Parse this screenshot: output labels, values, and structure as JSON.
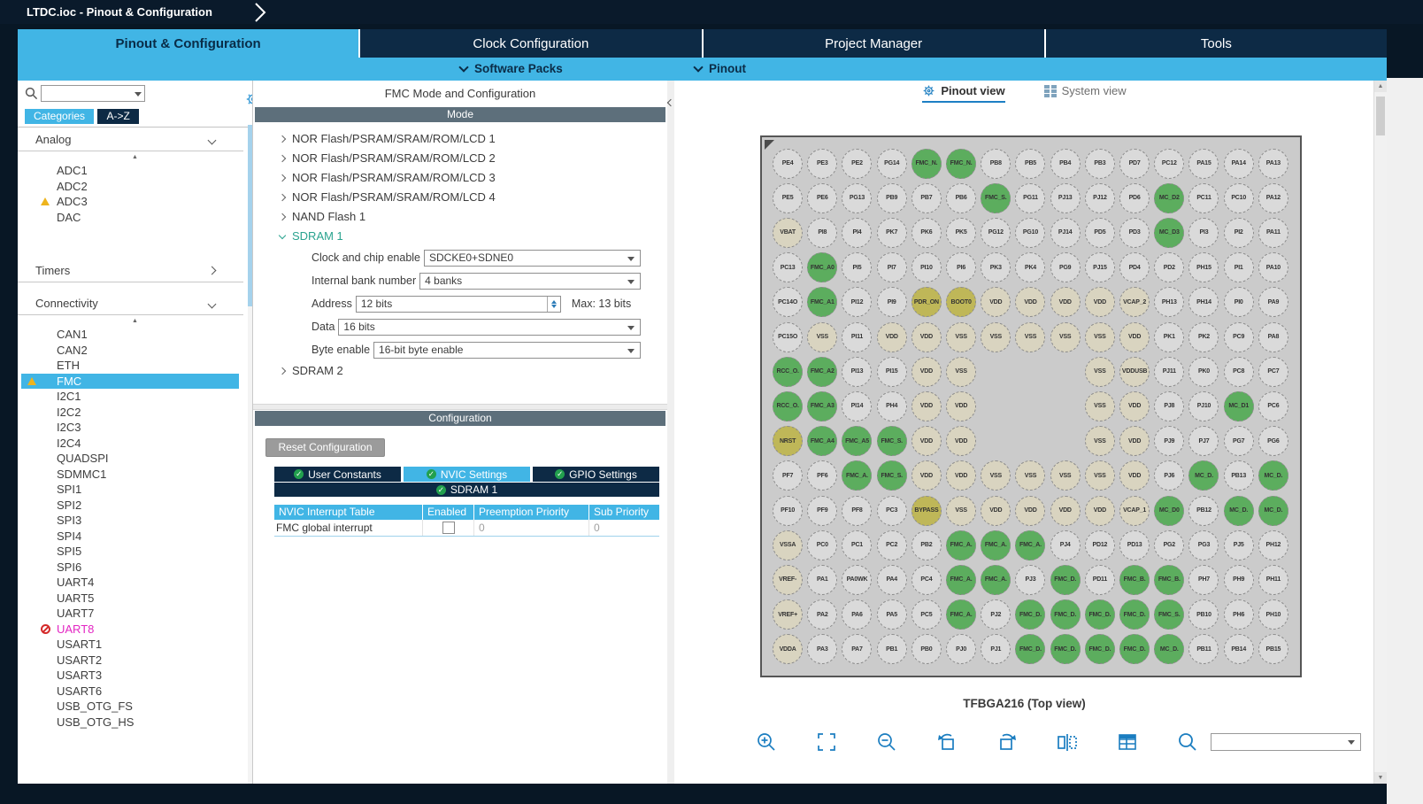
{
  "window": {
    "title": "LTDC.ioc - Pinout & Configuration"
  },
  "nav": {
    "tabs": [
      {
        "label": "Pinout & Configuration",
        "active": true
      },
      {
        "label": "Clock Configuration",
        "active": false
      },
      {
        "label": "Project Manager",
        "active": false
      },
      {
        "label": "Tools",
        "active": false
      }
    ],
    "subnav": [
      {
        "label": "Software Packs"
      },
      {
        "label": "Pinout"
      }
    ]
  },
  "sidebar": {
    "search_value": "",
    "tabs": [
      {
        "label": "Categories",
        "active": true
      },
      {
        "label": "A->Z",
        "active": false
      }
    ],
    "groups": [
      {
        "label": "Analog",
        "expanded": true,
        "items": [
          {
            "label": "ADC1"
          },
          {
            "label": "ADC2"
          },
          {
            "label": "ADC3",
            "warning": true
          },
          {
            "label": "DAC"
          }
        ]
      },
      {
        "label": "Timers",
        "expanded": false,
        "items": []
      },
      {
        "label": "Connectivity",
        "expanded": true,
        "items": [
          {
            "label": "CAN1"
          },
          {
            "label": "CAN2"
          },
          {
            "label": "ETH"
          },
          {
            "label": "FMC",
            "warning": true,
            "selected": true
          },
          {
            "label": "I2C1"
          },
          {
            "label": "I2C2"
          },
          {
            "label": "I2C3"
          },
          {
            "label": "I2C4"
          },
          {
            "label": "QUADSPI"
          },
          {
            "label": "SDMMC1"
          },
          {
            "label": "SPI1"
          },
          {
            "label": "SPI2"
          },
          {
            "label": "SPI3"
          },
          {
            "label": "SPI4"
          },
          {
            "label": "SPI5"
          },
          {
            "label": "SPI6"
          },
          {
            "label": "UART4"
          },
          {
            "label": "UART5"
          },
          {
            "label": "UART7"
          },
          {
            "label": "UART8",
            "blocked": true
          },
          {
            "label": "USART1"
          },
          {
            "label": "USART2"
          },
          {
            "label": "USART3"
          },
          {
            "label": "USART6"
          },
          {
            "label": "USB_OTG_FS"
          },
          {
            "label": "USB_OTG_HS"
          }
        ]
      }
    ]
  },
  "mode_panel": {
    "title": "FMC Mode and Configuration",
    "mode_header": "Mode",
    "tree": [
      {
        "label": "NOR Flash/PSRAM/SRAM/ROM/LCD 1",
        "expanded": false
      },
      {
        "label": "NOR Flash/PSRAM/SRAM/ROM/LCD 2",
        "expanded": false
      },
      {
        "label": "NOR Flash/PSRAM/SRAM/ROM/LCD 3",
        "expanded": false
      },
      {
        "label": "NOR Flash/PSRAM/SRAM/ROM/LCD 4",
        "expanded": false
      },
      {
        "label": "NAND Flash 1",
        "expanded": false
      },
      {
        "label": "SDRAM 1",
        "expanded": true
      },
      {
        "label": "SDRAM 2",
        "expanded": false
      }
    ],
    "sdram1_fields": [
      {
        "label": "Clock and chip enable",
        "type": "select",
        "value": "SDCKE0+SDNE0"
      },
      {
        "label": "Internal bank number",
        "type": "select",
        "value": "4 banks"
      },
      {
        "label": "Address",
        "type": "spinner",
        "value": "12 bits",
        "suffix": "Max: 13 bits"
      },
      {
        "label": "Data",
        "type": "select",
        "value": "16 bits"
      },
      {
        "label": "Byte enable",
        "type": "select",
        "value": "16-bit byte enable"
      }
    ],
    "config_header": "Configuration",
    "reset_button": "Reset Configuration",
    "config_tabs": [
      {
        "label": "User Constants",
        "active": false
      },
      {
        "label": "NVIC Settings",
        "active": true
      },
      {
        "label": "GPIO Settings",
        "active": false
      }
    ],
    "config_subheader": "SDRAM 1",
    "nvic_table": {
      "headers": [
        "NVIC Interrupt Table",
        "Enabled",
        "Preemption Priority",
        "Sub Priority"
      ],
      "rows": [
        {
          "name": "FMC global interrupt",
          "enabled": false,
          "preemption": "0",
          "sub": "0"
        }
      ]
    }
  },
  "pinout_panel": {
    "tabs": [
      {
        "label": "Pinout view",
        "active": true
      },
      {
        "label": "System view",
        "active": false
      }
    ],
    "caption": "TFBGA216 (Top view)",
    "ball_colors": {
      "d": "#dadada",
      "g": "#5cad5e",
      "p": "#d9d4c0",
      "o": "#bfb758"
    },
    "rows": [
      [
        "PE4|d",
        "PE3|d",
        "PE2|d",
        "PG14|d",
        "FMC_N.|g",
        "FMC_N.|g",
        "PB8|d",
        "PB5|d",
        "PB4|d",
        "PB3|d",
        "PD7|d",
        "PC12|d",
        "PA15|d",
        "PA14|d",
        "PA13|d"
      ],
      [
        "PE5|d",
        "PE6|d",
        "PG13|d",
        "PB9|d",
        "PB7|d",
        "PB6|d",
        "FMC_S.|g",
        "PG11|d",
        "PJ13|d",
        "PJ12|d",
        "PD6|d",
        "MC_D2|g",
        "PC11|d",
        "PC10|d",
        "PA12|d"
      ],
      [
        "VBAT|p",
        "PI8|d",
        "PI4|d",
        "PK7|d",
        "PK6|d",
        "PK5|d",
        "PG12|d",
        "PG10|d",
        "PJ14|d",
        "PD5|d",
        "PD3|d",
        "MC_D3|g",
        "PI3|d",
        "PI2|d",
        "PA11|d"
      ],
      [
        "PC13|d",
        "FMC_A0|g",
        "PI5|d",
        "PI7|d",
        "PI10|d",
        "PI6|d",
        "PK3|d",
        "PK4|d",
        "PG9|d",
        "PJ15|d",
        "PD4|d",
        "PD2|d",
        "PH15|d",
        "PI1|d",
        "PA10|d"
      ],
      [
        "PC14O|d",
        "FMC_A1|g",
        "PI12|d",
        "PI9|d",
        "PDR_ON|o",
        "BOOT0|o",
        "VDD|p",
        "VDD|p",
        "VDD|p",
        "VDD|p",
        "VCAP_2|p",
        "PH13|d",
        "PH14|d",
        "PI0|d",
        "PA9|d"
      ],
      [
        "PC15O|d",
        "VSS|p",
        "PI11|d",
        "VDD|p",
        "VDD|p",
        "VSS|p",
        "VSS|p",
        "VSS|p",
        "VSS|p",
        "VSS|p",
        "VDD|p",
        "PK1|d",
        "PK2|d",
        "PC9|d",
        "PA8|d"
      ],
      [
        "RCC_O.|g",
        "FMC_A2|g",
        "PI13|d",
        "PI15|d",
        "VDD|p",
        "VSS|p",
        "",
        "",
        "",
        "VSS|p",
        "VDDUSB|p",
        "PJ11|d",
        "PK0|d",
        "PC8|d",
        "PC7|d"
      ],
      [
        "RCC_O.|g",
        "FMC_A3|g",
        "PI14|d",
        "PH4|d",
        "VDD|p",
        "VDD|p",
        "",
        "",
        "",
        "VSS|p",
        "VDD|p",
        "PJ8|d",
        "PJ10|d",
        "MC_D1|g",
        "PC6|d"
      ],
      [
        "NRST|o",
        "FMC_A4|g",
        "FMC_A5|g",
        "FMC_S.|g",
        "VDD|p",
        "VDD|p",
        "",
        "",
        "",
        "VSS|p",
        "VDD|p",
        "PJ9|d",
        "PJ7|d",
        "PG7|d",
        "PG6|d"
      ],
      [
        "PF7|d",
        "PF6|d",
        "FMC_A.|g",
        "FMC_S.|g",
        "VDD|p",
        "VDD|p",
        "VSS|p",
        "VSS|p",
        "VSS|p",
        "VSS|p",
        "VDD|p",
        "PJ6|d",
        "MC_D.|g",
        "PB13|d",
        "MC_D.|g"
      ],
      [
        "PF10|d",
        "PF9|d",
        "PF8|d",
        "PC3|d",
        "BYPASS|o",
        "VSS|p",
        "VDD|p",
        "VDD|p",
        "VDD|p",
        "VDD|p",
        "VCAP_1|p",
        "MC_D0|g",
        "PB12|d",
        "MC_D.|g",
        "MC_D.|g"
      ],
      [
        "VSSA|p",
        "PC0|d",
        "PC1|d",
        "PC2|d",
        "PB2|d",
        "FMC_A.|g",
        "FMC_A.|g",
        "FMC_A.|g",
        "PJ4|d",
        "PD12|d",
        "PD13|d",
        "PG2|d",
        "PG3|d",
        "PJ5|d",
        "PH12|d"
      ],
      [
        "VREF-|p",
        "PA1|d",
        "PA0WK|d",
        "PA4|d",
        "PC4|d",
        "FMC_A.|g",
        "FMC_A.|g",
        "PJ3|d",
        "FMC_D.|g",
        "PD11|d",
        "FMC_B.|g",
        "FMC_B.|g",
        "PH7|d",
        "PH9|d",
        "PH11|d"
      ],
      [
        "VREF+|p",
        "PA2|d",
        "PA6|d",
        "PA5|d",
        "PC5|d",
        "FMC_A.|g",
        "PJ2|d",
        "FMC_D.|g",
        "FMC_D.|g",
        "FMC_D.|g",
        "FMC_D.|g",
        "FMC_S.|g",
        "PB10|d",
        "PH6|d",
        "PH10|d"
      ],
      [
        "VDDA|p",
        "PA3|d",
        "PA7|d",
        "PB1|d",
        "PB0|d",
        "PJ0|d",
        "PJ1|d",
        "FMC_D.|g",
        "FMC_D.|g",
        "FMC_D.|g",
        "FMC_D.|g",
        "MC_D.|g",
        "PB11|d",
        "PB14|d",
        "PB15|d"
      ]
    ]
  },
  "toolbar": {
    "icons": [
      "zoom-in",
      "zoom-to-fit",
      "zoom-out",
      "rotate-counterclockwise",
      "rotate-clockwise",
      "flip-view",
      "pins-table",
      "search"
    ],
    "search_value": ""
  },
  "icon_names": [
    "search-icon",
    "settings-gear-icon",
    "warning-icon",
    "not-available-icon",
    "check-icon",
    "chevron-down-icon",
    "chevron-right-icon",
    "scroll-up-icon",
    "pinout-view-gear-icon",
    "system-view-icon",
    "zoom-in-icon",
    "zoom-to-fit-icon",
    "zoom-out-icon",
    "rotate-counterclockwise-icon",
    "rotate-clockwise-icon",
    "flip-view-icon",
    "pins-table-icon",
    "package-search-icon",
    "collapse-panel-icon",
    "pin1-marker"
  ]
}
